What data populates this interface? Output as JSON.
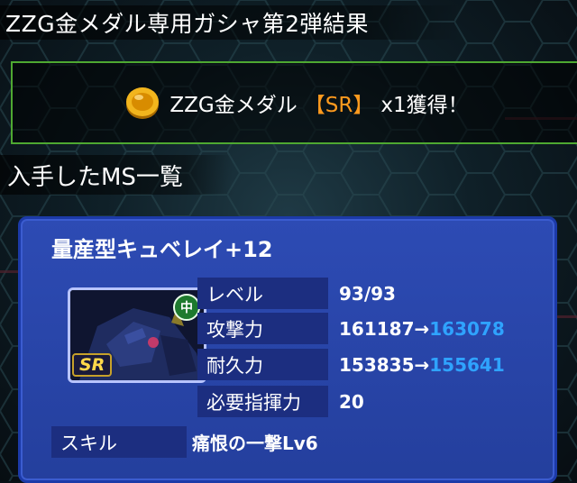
{
  "header": {
    "title": "ZZG金メダル専用ガシャ第2弾結果"
  },
  "reward": {
    "item_name": "ZZG金メダル",
    "rarity": "【SR】",
    "suffix": "x1獲得！",
    "icon": "gold-medal-coin-icon"
  },
  "subheader": {
    "title": "入手したMS一覧"
  },
  "ms": {
    "name": "量産型キュベレイ+12",
    "rarity_badge": "SR",
    "size_badge": "中",
    "stats": [
      {
        "label": "レベル",
        "value": "93/93",
        "new_value": ""
      },
      {
        "label": "攻撃力",
        "value": "161187→",
        "new_value": "163078"
      },
      {
        "label": "耐久力",
        "value": "153835→",
        "new_value": "155641"
      },
      {
        "label": "必要指揮力",
        "value": "20",
        "new_value": ""
      }
    ],
    "skill": {
      "label": "スキル",
      "value": "痛恨の一撃Lv6"
    }
  },
  "colors": {
    "accent_green": "#4ea831",
    "rarity_orange": "#ff9a1e",
    "stat_up_blue": "#2fa3ff",
    "card_blue": "#2d4bb4"
  }
}
